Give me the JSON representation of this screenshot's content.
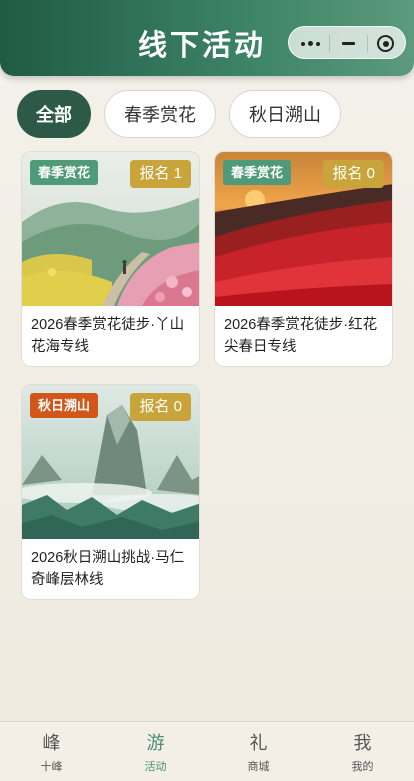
{
  "header": {
    "title": "线下活动"
  },
  "filters": [
    {
      "label": "全部",
      "active": true
    },
    {
      "label": "春季赏花",
      "active": false
    },
    {
      "label": "秋日溯山",
      "active": false
    }
  ],
  "activities": [
    {
      "category": "春季赏花",
      "category_color": "#4f9a78",
      "signup": "报名 1",
      "title": "2026春季赏花徒步·丫山花海专线",
      "image": "spring-hill-flowers"
    },
    {
      "category": "春季赏花",
      "category_color": "#4f9a78",
      "signup": "报名 0",
      "title": "2026春季赏花徒步·红花尖春日专线",
      "image": "red-flower-sunset"
    },
    {
      "category": "秋日溯山",
      "category_color": "#d2561a",
      "signup": "报名 0",
      "title": "2026秋日溯山挑战·马仁奇峰层林线",
      "image": "misty-peaks"
    }
  ],
  "tabbar": [
    {
      "icon": "峰",
      "label": "十峰",
      "active": false
    },
    {
      "icon": "游",
      "label": "活动",
      "active": true
    },
    {
      "icon": "礼",
      "label": "商城",
      "active": false
    },
    {
      "icon": "我",
      "label": "我的",
      "active": false
    }
  ]
}
